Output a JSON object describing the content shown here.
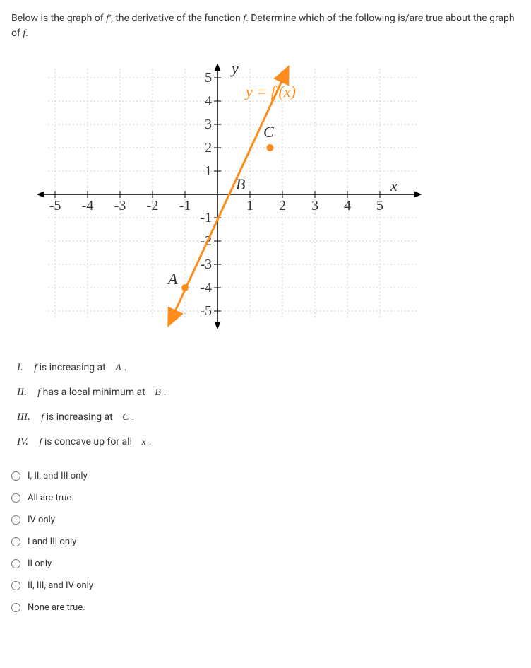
{
  "question": {
    "prefix": "Below is the graph of ",
    "fprime": "f′",
    "middle": ", the derivative of the function ",
    "f": "f",
    "suffix": ". Determine which of the following is/are true about the graph of ",
    "f2": "f",
    "end": "."
  },
  "chart_data": {
    "type": "line",
    "xlim": [
      -5.8,
      5.8
    ],
    "ylim": [
      -5.5,
      5.5
    ],
    "xlabel": "x",
    "ylabel": "y",
    "equation_label": "y = f′(x)",
    "xticks": [
      -5,
      -4,
      -3,
      -2,
      -1,
      1,
      2,
      3,
      4,
      5
    ],
    "yticks": [
      -5,
      -4,
      -3,
      -2,
      -1,
      1,
      2,
      3,
      4,
      5
    ],
    "line": {
      "slope": 3,
      "intercept": -1,
      "color": "#ff8c1a",
      "domain_shown": [
        -1.4,
        2.1
      ]
    },
    "points": [
      {
        "name": "A",
        "x": -1,
        "y": -4,
        "color": "#ff8c1a",
        "label_pos": "left"
      },
      {
        "name": "B",
        "x": 1,
        "y": 0,
        "color": "#333",
        "label_pos": "left-up",
        "axis_label_only": true
      },
      {
        "name": "C",
        "x": 1.4,
        "y": 2,
        "color": "#ff8c1a",
        "label_pos": "above-left",
        "axis_label_only": true
      }
    ]
  },
  "statements": {
    "I": {
      "num": "I.",
      "pre": "f ",
      "text": "is increasing at",
      "lbl": "A",
      "post": "."
    },
    "II": {
      "num": "II.",
      "pre": "f ",
      "text": "has a local minimum at",
      "lbl": "B",
      "post": "."
    },
    "III": {
      "num": "III.",
      "pre": "f ",
      "text": "is increasing at",
      "lbl": "C",
      "post": "."
    },
    "IV": {
      "num": "IV.",
      "pre": "f ",
      "text": "is concave up for all",
      "lbl": "x",
      "post": "."
    }
  },
  "options": {
    "a": "I, II, and III only",
    "b": "All are true.",
    "c": "IV only",
    "d": "I and III only",
    "e": "II only",
    "f": "II, III,  and IV only",
    "g": "None are true."
  }
}
